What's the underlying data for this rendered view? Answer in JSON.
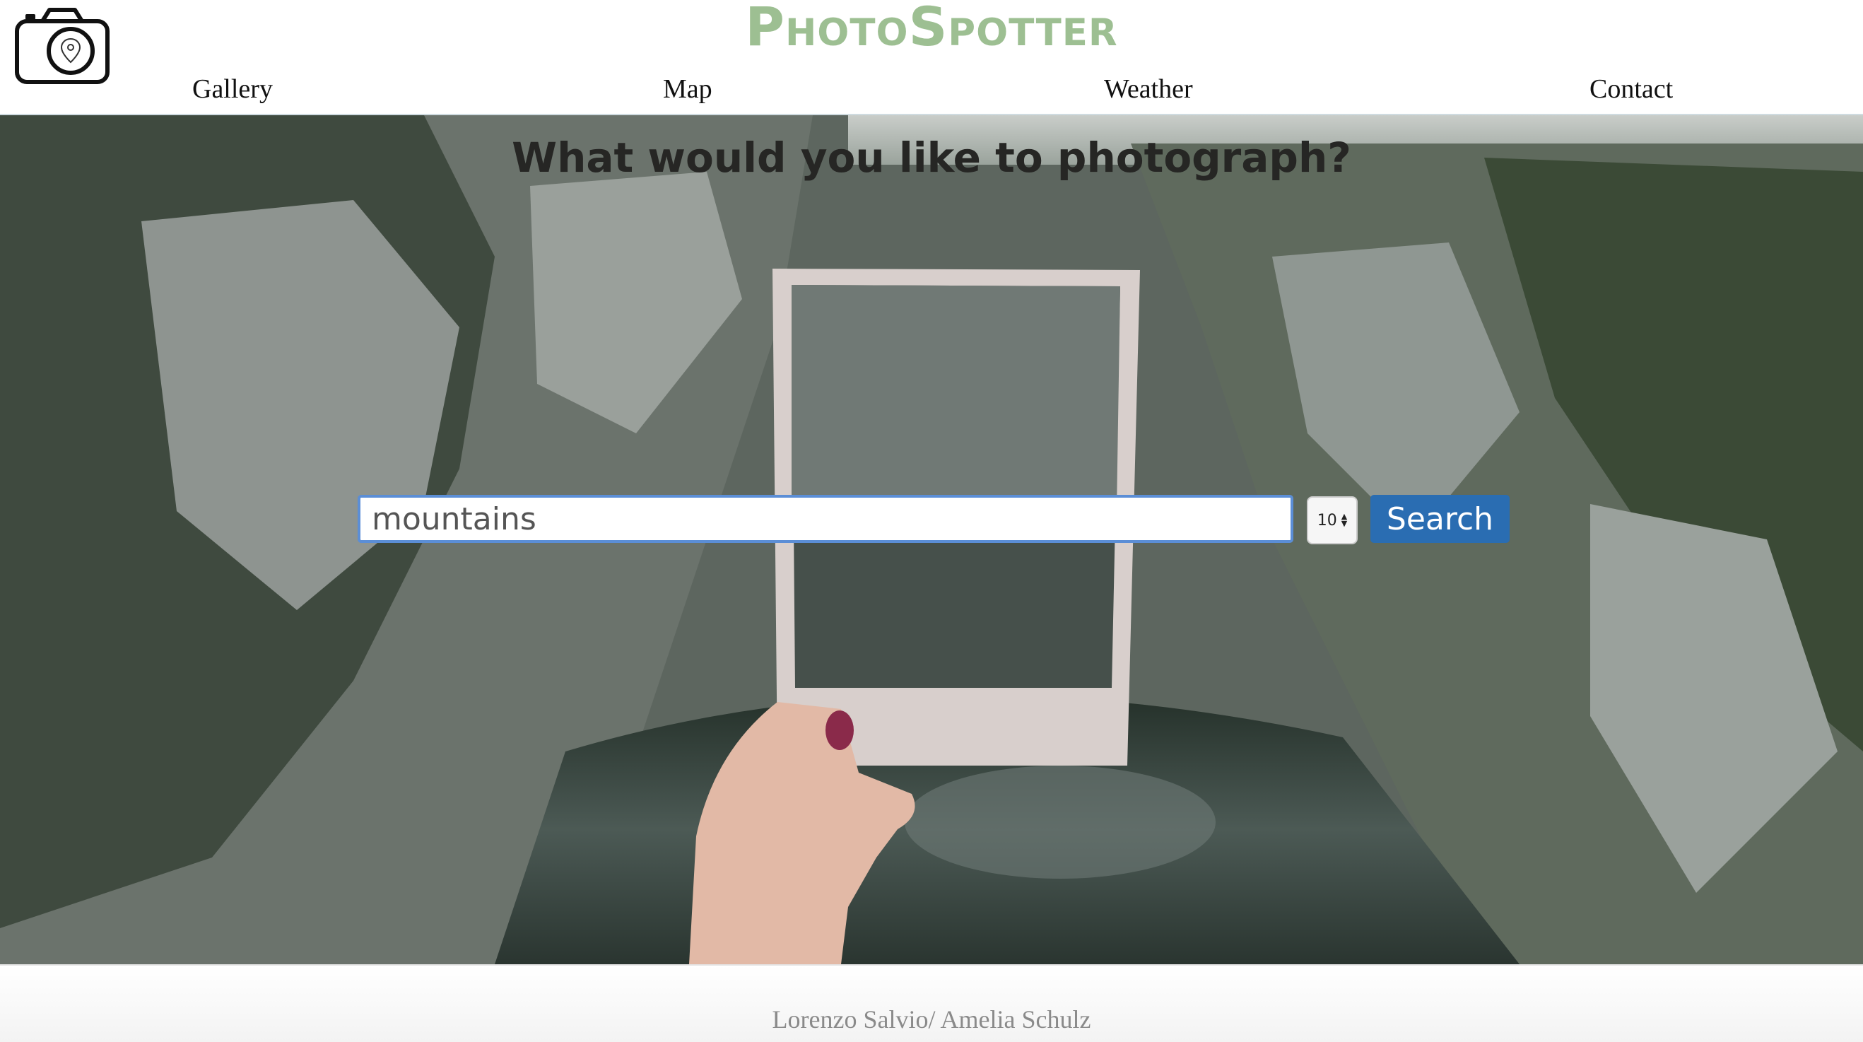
{
  "header": {
    "brand": "PhotoSpotter",
    "logo_icon": "camera-location-icon",
    "nav": [
      {
        "label": "Gallery"
      },
      {
        "label": "Map"
      },
      {
        "label": "Weather"
      },
      {
        "label": "Contact"
      }
    ]
  },
  "hero": {
    "title": "What would you like to photograph?",
    "background": "hand holding empty photo frame over canyon lake",
    "search": {
      "value": "mountains",
      "placeholder": ""
    },
    "count": {
      "selected": "10"
    },
    "search_button_label": "Search"
  },
  "footer": {
    "credits": "Lorenzo Salvio/ Amelia Schulz"
  },
  "colors": {
    "brand": "#9dbf92",
    "button": "#2a6db2",
    "input_focus_border": "#5b8ed6"
  }
}
